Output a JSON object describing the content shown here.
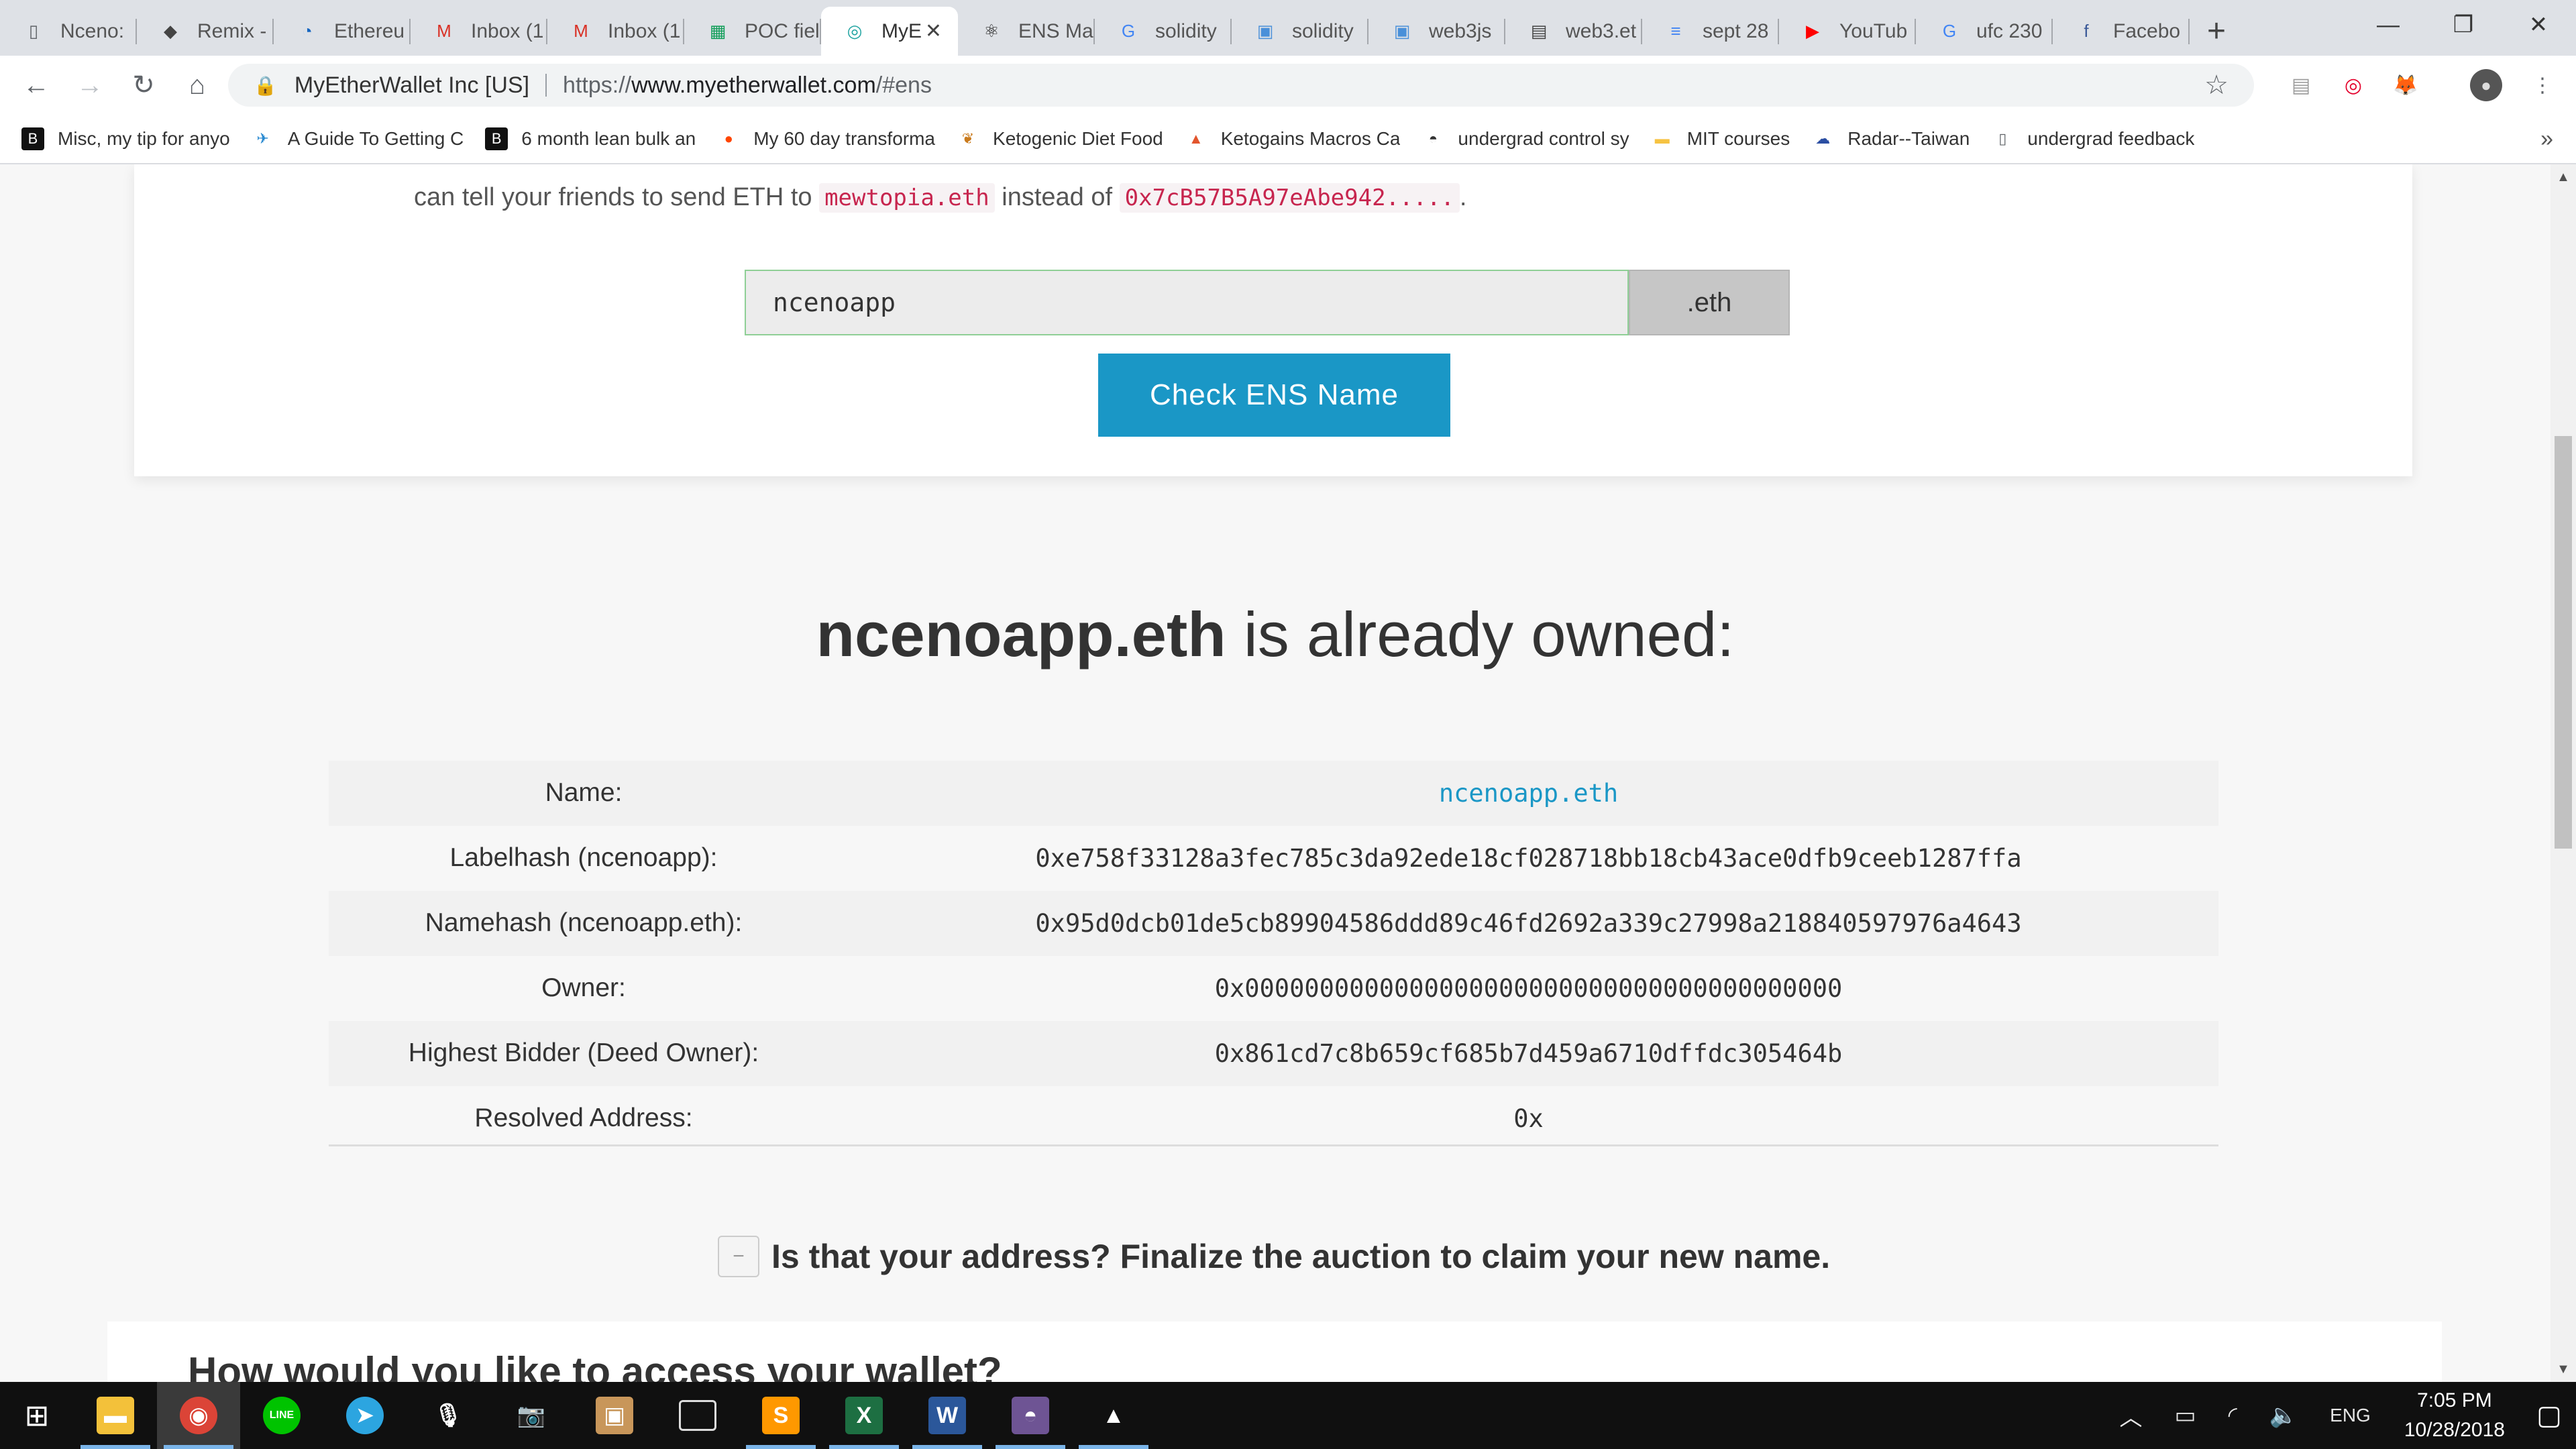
{
  "tabs": [
    {
      "label": "Nceno:",
      "icon": "document-icon",
      "icon_color": "#5f6368",
      "active": false
    },
    {
      "label": "Remix -",
      "icon": "ethereum-icon",
      "icon_color": "#444444",
      "active": false
    },
    {
      "label": "Ethereu",
      "icon": "chart-icon",
      "icon_color": "#1565c0",
      "active": false
    },
    {
      "label": "Inbox (1",
      "icon": "gmail-icon",
      "icon_color": "#d93025",
      "active": false
    },
    {
      "label": "Inbox (1",
      "icon": "gmail-icon",
      "icon_color": "#d93025",
      "active": false
    },
    {
      "label": "POC fiel",
      "icon": "sheets-icon",
      "icon_color": "#0f9d58",
      "active": false
    },
    {
      "label": "MyE",
      "icon": "myetherwallet-icon",
      "icon_color": "#1fa3a0",
      "active": true
    },
    {
      "label": "ENS Ma",
      "icon": "react-icon",
      "icon_color": "#222222",
      "active": false
    },
    {
      "label": "solidity",
      "icon": "google-icon",
      "icon_color": "#4285f4",
      "active": false
    },
    {
      "label": "solidity",
      "icon": "eth-docs-icon",
      "icon_color": "#4a90d9",
      "active": false
    },
    {
      "label": "web3js",
      "icon": "eth-docs-icon",
      "icon_color": "#4a90d9",
      "active": false
    },
    {
      "label": "web3.et",
      "icon": "book-icon",
      "icon_color": "#444444",
      "active": false
    },
    {
      "label": "sept 28",
      "icon": "docs-icon",
      "icon_color": "#4285f4",
      "active": false
    },
    {
      "label": "YouTub",
      "icon": "youtube-icon",
      "icon_color": "#ff0000",
      "active": false
    },
    {
      "label": "ufc 230",
      "icon": "google-icon",
      "icon_color": "#4285f4",
      "active": false
    },
    {
      "label": "Facebo",
      "icon": "facebook-icon",
      "icon_color": "#3b5998",
      "active": false
    }
  ],
  "address_bar": {
    "site_identity": "MyEtherWallet Inc [US]",
    "url_prefix": "https://",
    "url_host": "www.myetherwallet.com",
    "url_path": "/#ens"
  },
  "bookmarks": [
    {
      "label": "Misc, my tip for anyo",
      "icon": "bodybuilding-icon",
      "icon_color": "#111111"
    },
    {
      "label": "A Guide To Getting C",
      "icon": "bird-icon",
      "icon_color": "#2a8ad1"
    },
    {
      "label": "6 month lean bulk an",
      "icon": "bodybuilding-icon",
      "icon_color": "#111111"
    },
    {
      "label": "My 60 day transforma",
      "icon": "reddit-icon",
      "icon_color": "#ff4500"
    },
    {
      "label": "Ketogenic Diet Food",
      "icon": "leaf-icon",
      "icon_color": "#c97a1c"
    },
    {
      "label": "Ketogains Macros Ca",
      "icon": "triangle-icon",
      "icon_color": "#e2552d"
    },
    {
      "label": "undergrad control sy",
      "icon": "github-icon",
      "icon_color": "#333333"
    },
    {
      "label": "MIT courses",
      "icon": "folder-icon",
      "icon_color": "#f6c342"
    },
    {
      "label": "Radar--Taiwan",
      "icon": "weather-icon",
      "icon_color": "#2b4ea2"
    },
    {
      "label": "undergrad feedback",
      "icon": "document-icon",
      "icon_color": "#5f6368"
    }
  ],
  "ens": {
    "intro_prefix": "can tell your friends to send ETH to",
    "intro_example_name": "mewtopia.eth",
    "intro_middle": "instead of",
    "intro_example_address": "0x7cB57B5A97eAbe942.....",
    "intro_suffix": ".",
    "input_value": "ncenoapp",
    "tld": ".eth",
    "check_button": "Check ENS Name"
  },
  "result": {
    "name": "ncenoapp.eth",
    "heading_suffix": "is already owned:",
    "rows": [
      {
        "label": "Name:",
        "value": "ncenoapp.eth",
        "is_link": true
      },
      {
        "label": "Labelhash (ncenoapp):",
        "value": "0xe758f33128a3fec785c3da92ede18cf028718bb18cb43ace0dfb9ceeb1287ffa",
        "is_link": false
      },
      {
        "label": "Namehash (ncenoapp.eth):",
        "value": "0x95d0dcb01de5cb89904586ddd89c46fd2692a339c27998a218840597976a4643",
        "is_link": false
      },
      {
        "label": "Owner:",
        "value": "0x0000000000000000000000000000000000000000",
        "is_link": false
      },
      {
        "label": "Highest Bidder (Deed Owner):",
        "value": "0x861cd7c8b659cf685b7d459a6710dffdc305464b",
        "is_link": false
      },
      {
        "label": "Resolved Address:",
        "value": "0x",
        "is_link": false
      }
    ],
    "finalize_toggle": "−",
    "finalize_text": "Is that your address? Finalize the auction to claim your new name.",
    "access_heading": "How would you like to access your wallet?"
  },
  "taskbar": {
    "apps": [
      {
        "name": "file-explorer-icon",
        "color": "#f3c13a",
        "glyph": "▬",
        "open": true,
        "active": false
      },
      {
        "name": "chrome-icon",
        "color": "#db4437",
        "glyph": "◉",
        "open": true,
        "active": true
      },
      {
        "name": "line-icon",
        "color": "#00c300",
        "glyph": "LINE",
        "open": false,
        "active": false
      },
      {
        "name": "telegram-icon",
        "color": "#2ca5e0",
        "glyph": "➤",
        "open": false,
        "active": false
      },
      {
        "name": "voice-recorder-icon",
        "color": "#ffffff",
        "glyph": "🎙",
        "open": false,
        "active": false
      },
      {
        "name": "camera-icon",
        "color": "#ffffff",
        "glyph": "📷",
        "open": false,
        "active": false
      },
      {
        "name": "package-icon",
        "color": "#c8965a",
        "glyph": "▣",
        "open": false,
        "active": false
      },
      {
        "name": "terminal-icon",
        "color": "#222222",
        "glyph": "▭",
        "open": false,
        "active": false
      },
      {
        "name": "sublime-text-icon",
        "color": "#ff9800",
        "glyph": "S",
        "open": true,
        "active": false
      },
      {
        "name": "excel-icon",
        "color": "#1d6f42",
        "glyph": "X",
        "open": true,
        "active": false
      },
      {
        "name": "word-icon",
        "color": "#2b579a",
        "glyph": "W",
        "open": true,
        "active": false
      },
      {
        "name": "github-desktop-icon",
        "color": "#6e5494",
        "glyph": "◓",
        "open": true,
        "active": false
      },
      {
        "name": "photos-icon",
        "color": "#ffffff",
        "glyph": "▲",
        "open": true,
        "active": false
      }
    ],
    "language": "ENG",
    "time": "7:05 PM",
    "date": "10/28/2018"
  }
}
